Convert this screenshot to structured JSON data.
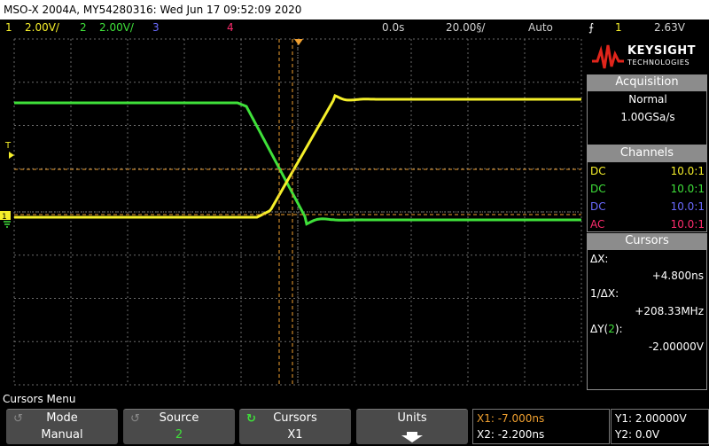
{
  "title": "MSO-X 2004A, MY54280316: Wed Jun 17 09:52:09 2020",
  "status": {
    "ch1_num": "1",
    "ch1_scale": "2.00V/",
    "ch2_num": "2",
    "ch2_scale": "2.00V/",
    "ch3_num": "3",
    "ch4_num": "4",
    "delay": "0.0s",
    "timebase": "20.00§/",
    "trigger_mode": "Auto",
    "trigger_slope_icon": "rising-edge-icon",
    "trigger_src": "1",
    "trigger_level": "2.63V"
  },
  "logo": {
    "name": "KEYSIGHT",
    "sub": "TECHNOLOGIES"
  },
  "acquisition": {
    "header": "Acquisition",
    "mode": "Normal",
    "rate": "1.00GSa/s"
  },
  "channels": {
    "header": "Channels",
    "rows": [
      {
        "coupling": "DC",
        "probe": "10.0:1",
        "color": "#f5ef2a"
      },
      {
        "coupling": "DC",
        "probe": "10.0:1",
        "color": "#3fe03a"
      },
      {
        "coupling": "DC",
        "probe": "10.0:1",
        "color": "#6a6aff"
      },
      {
        "coupling": "AC",
        "probe": "10.0:1",
        "color": "#ff2c6e"
      }
    ]
  },
  "cursors": {
    "header": "Cursors",
    "dx_label": "ΔX:",
    "dx_value": "+4.800ns",
    "inv_label": "1/ΔX:",
    "inv_value": "+208.33MHz",
    "dy_label_pre": "ΔY(",
    "dy_label_ch": "2",
    "dy_label_post": "):",
    "dy_value": "-2.00000V"
  },
  "menu": {
    "title": "Cursors Menu"
  },
  "softkeys": [
    {
      "title": "Mode",
      "value": "Manual"
    },
    {
      "title": "Source",
      "value": "2"
    },
    {
      "title": "Cursors",
      "value": "X1"
    },
    {
      "title": "Units",
      "value": ""
    }
  ],
  "readout": {
    "x1": "X1: -7.000ns",
    "x2": "X2: -2.200ns",
    "y1": "Y1: 2.00000V",
    "y2": "Y2: 0.0V"
  },
  "colors": {
    "ch1": "#f5ef2a",
    "ch2": "#3fe03a",
    "ch3": "#6a6aff",
    "ch4": "#ff2c6e",
    "cursor": "#f0a030",
    "grid": "#6a6a6a"
  },
  "markers": {
    "trigger_level_label": "T",
    "ground_label": "1"
  }
}
